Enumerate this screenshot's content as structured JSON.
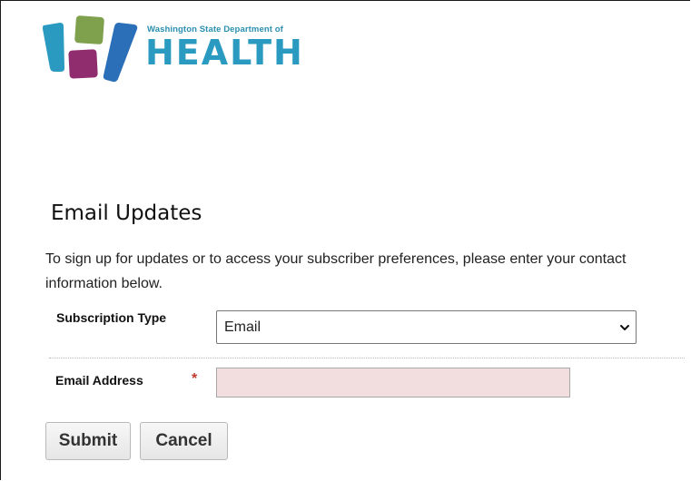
{
  "header": {
    "logo_subtitle": "Washington State Department of",
    "logo_title": "HEALTH",
    "logo_colors": {
      "bar_left": "#2b9ac0",
      "square_top": "#7fa04d",
      "square_bottom": "#8f2d6e",
      "bar_right": "#2a6fb8"
    }
  },
  "page": {
    "title": "Email Updates",
    "intro": "To sign up for updates or to access your subscriber preferences, please enter your contact information below."
  },
  "form": {
    "subscription_type": {
      "label": "Subscription Type",
      "selected": "Email",
      "icon": "chevron-down-icon"
    },
    "email": {
      "label": "Email Address",
      "required_marker": "*",
      "value": "",
      "placeholder": "",
      "background": "#f2dede"
    },
    "buttons": {
      "submit_label": "Submit",
      "cancel_label": "Cancel"
    }
  }
}
